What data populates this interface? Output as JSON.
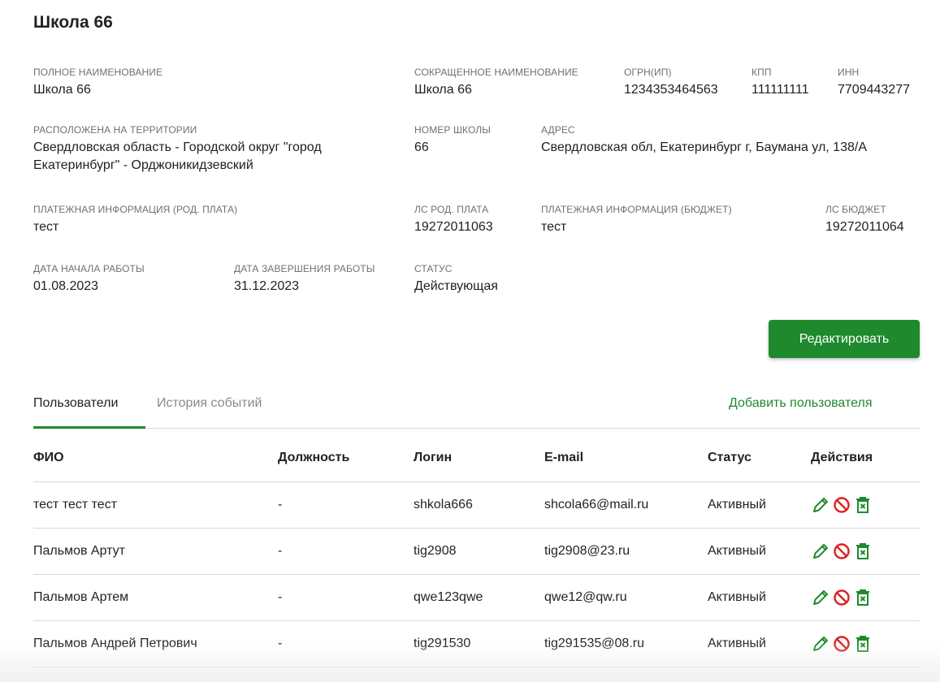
{
  "school": {
    "title": "Школа 66",
    "fields": {
      "full_name": {
        "label": "ПОЛНОЕ НАИМЕНОВАНИЕ",
        "value": "Школа 66"
      },
      "short_name": {
        "label": "СОКРАЩЕННОЕ НАИМЕНОВАНИЕ",
        "value": "Школа 66"
      },
      "ogrn": {
        "label": "ОГРН(ИП)",
        "value": "1234353464563"
      },
      "kpp": {
        "label": "КПП",
        "value": "111111111"
      },
      "inn": {
        "label": "ИНН",
        "value": "7709443277"
      },
      "territory": {
        "label": "РАСПОЛОЖЕНА НА ТЕРРИТОРИИ",
        "value": "Свердловская область - Городской округ \"город Екатеринбург\" - Орджоникидзевский"
      },
      "school_number": {
        "label": "НОМЕР ШКОЛЫ",
        "value": "66"
      },
      "address": {
        "label": "АДРЕС",
        "value": "Свердловская обл, Екатеринбург г, Баумана ул, 138/А"
      },
      "pay_parent": {
        "label": "ПЛАТЕЖНАЯ ИНФОРМАЦИЯ (РОД. ПЛАТА)",
        "value": "тест"
      },
      "ls_parent": {
        "label": "ЛС РОД. ПЛАТА",
        "value": "19272011063"
      },
      "pay_budget": {
        "label": "ПЛАТЕЖНАЯ ИНФОРМАЦИЯ (БЮДЖЕТ)",
        "value": "тест"
      },
      "ls_budget": {
        "label": "ЛС БЮДЖЕТ",
        "value": "19272011064"
      },
      "start_date": {
        "label": "ДАТА НАЧАЛА РАБОТЫ",
        "value": "01.08.2023"
      },
      "end_date": {
        "label": "ДАТА ЗАВЕРШЕНИЯ РАБОТЫ",
        "value": "31.12.2023"
      },
      "status": {
        "label": "СТАТУС",
        "value": "Действующая"
      }
    },
    "edit_button": "Редактировать"
  },
  "tabs": [
    {
      "label": "Пользователи",
      "active": true
    },
    {
      "label": "История событий",
      "active": false
    }
  ],
  "add_user_link": "Добавить пользователя",
  "table": {
    "headers": [
      "ФИО",
      "Должность",
      "Логин",
      "E-mail",
      "Статус",
      "Действия"
    ],
    "rows": [
      {
        "name": "тест тест тест",
        "position": "-",
        "login": "shkola666",
        "email": "shcola66@mail.ru",
        "status": "Активный"
      },
      {
        "name": "Пальмов Артут",
        "position": "-",
        "login": "tig2908",
        "email": "tig2908@23.ru",
        "status": "Активный"
      },
      {
        "name": "Пальмов Артем",
        "position": "-",
        "login": "qwe123qwe",
        "email": "qwe12@qw.ru",
        "status": "Активный"
      },
      {
        "name": "Пальмов Андрей Петрович",
        "position": "-",
        "login": "tig291530",
        "email": "tig291535@08.ru",
        "status": "Активный"
      }
    ],
    "action_icons": [
      "pencil-icon",
      "block-icon",
      "trash-icon"
    ]
  },
  "colors": {
    "accent": "#1f8a2d",
    "danger": "#e02020",
    "label": "#707070"
  }
}
